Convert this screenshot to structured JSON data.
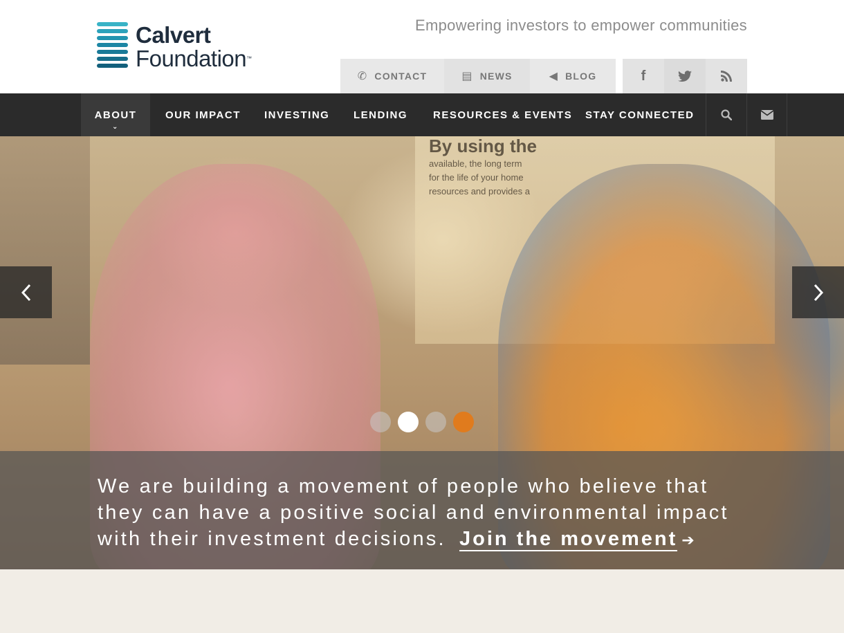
{
  "header": {
    "logo": {
      "line1": "Calvert",
      "line2": "Foundation",
      "tm": "™"
    },
    "tagline": "Empowering investors to empower communities",
    "utility_nav": [
      {
        "label": "CONTACT",
        "icon": "phone-icon"
      },
      {
        "label": "NEWS",
        "icon": "document-icon"
      },
      {
        "label": "BLOG",
        "icon": "megaphone-icon"
      }
    ],
    "social": [
      {
        "icon": "facebook-icon",
        "glyph": "f"
      },
      {
        "icon": "twitter-icon",
        "glyph": "🐦"
      },
      {
        "icon": "rss-icon",
        "glyph": "◜"
      }
    ]
  },
  "main_nav": {
    "items": [
      {
        "label": "ABOUT",
        "active": true
      },
      {
        "label": "OUR IMPACT"
      },
      {
        "label": "INVESTING"
      },
      {
        "label": "LENDING"
      },
      {
        "label": "RESOURCES & EVENTS"
      },
      {
        "label": "STAY CONNECTED"
      }
    ],
    "icons": [
      "search-icon",
      "envelope-icon"
    ]
  },
  "hero": {
    "poster_lines": [
      "By using the",
      "available, the long term",
      "for the life of your home",
      "resources and provides a"
    ],
    "caption": "We are building a movement of people who believe that they can have a positive social and environmental impact with their investment decisions.",
    "cta": "Join the movement",
    "slides": {
      "count": 4,
      "active_index": 1,
      "highlight_index": 3
    }
  },
  "colors": {
    "nav_bg": "#2b2b2b",
    "accent": "#e07b1d",
    "logo_blue": "#1a8fa8",
    "logo_navy": "#1f2d3d"
  }
}
